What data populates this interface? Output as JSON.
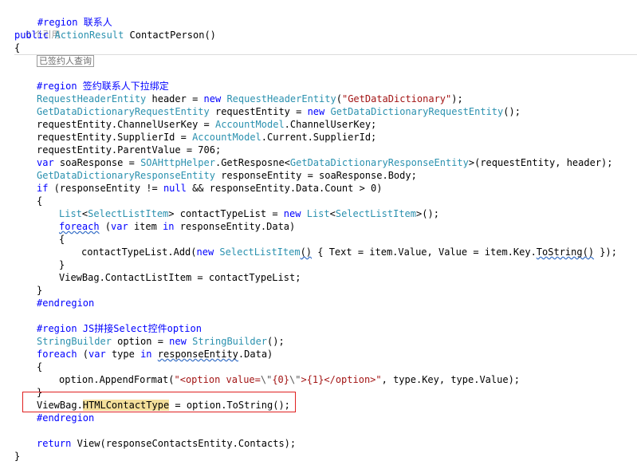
{
  "code": {
    "region_contact": "#region 联系人",
    "references": "0 个引用",
    "method_modifier": "public",
    "method_return_type": "ActionResult",
    "method_name": " ContactPerson()",
    "open_brace": "{",
    "collapsed_block_label": "已签约人查询",
    "region_signed_contact": "#region 签约联系人下拉绑定",
    "l1_type": "RequestHeaderEntity",
    "l1_mid": " header = ",
    "l1_new": "new",
    "l1_type2": "RequestHeaderEntity",
    "l1_paren": "(",
    "l1_str": "\"GetDataDictionary\"",
    "l1_end": ");",
    "l2_type": "GetDataDictionaryRequestEntity",
    "l2_mid": " requestEntity = ",
    "l2_new": "new",
    "l2_type2": "GetDataDictionaryRequestEntity",
    "l2_end": "();",
    "l3_a": "requestEntity.ChannelUserKey = ",
    "l3_type": "AccountModel",
    "l3_b": ".ChannelUserKey;",
    "l4_a": "requestEntity.SupplierId = ",
    "l4_type": "AccountModel",
    "l4_b": ".Current.SupplierId;",
    "l5": "requestEntity.ParentValue = 706;",
    "l6_var": "var",
    "l6_a": " soaResponse = ",
    "l6_type": "SOAHttpHelper",
    "l6_b": ".GetResposne<",
    "l6_type2": "GetDataDictionaryResponseEntity",
    "l6_c": ">(requestEntity, header);",
    "l7_type": "GetDataDictionaryResponseEntity",
    "l7_a": " responseEntity = soaResponse.Body;",
    "l8_if": "if",
    "l8_a": " (responseEntity != ",
    "l8_null": "null",
    "l8_b": " && responseEntity.Data.Count > 0)",
    "l9": "{",
    "l10_list": "List",
    "l10_a": "<",
    "l10_type": "SelectListItem",
    "l10_b": "> contactTypeList = ",
    "l10_new": "new",
    "l10_list2": "List",
    "l10_c": "<",
    "l10_type2": "SelectListItem",
    "l10_d": ">();",
    "l11_foreach": "foreach",
    "l11_a": " (",
    "l11_var": "var",
    "l11_b": " item ",
    "l11_in": "in",
    "l11_c": " responseEntity.Data)",
    "l12": "{",
    "l13_a": "contactTypeList.Add(",
    "l13_new": "new",
    "l13_type": "SelectListItem",
    "l13_paren": "()",
    "l13_b": " { Text = item.Value, Value = item.Key.",
    "l13_tostring": "ToString()",
    "l13_c": " });",
    "l14": "}",
    "l15": "ViewBag.ContactListItem = contactTypeList;",
    "l16": "}",
    "endregion_1": "#endregion",
    "region_js": "#region JS拼接Select控件option",
    "l17_type": "StringBuilder",
    "l17_a": " option = ",
    "l17_new": "new",
    "l17_type2": "StringBuilder",
    "l17_b": "();",
    "l18_foreach": "foreach",
    "l18_a": " (",
    "l18_var": "var",
    "l18_b": " type ",
    "l18_in": "in",
    "l18_c": " ",
    "l18_resp": "responseEntity",
    "l18_d": ".Data)",
    "l19": "{",
    "l20_a": "option.AppendFormat(",
    "l20_s1": "\"<option value=",
    "l20_e1": "\\\"",
    "l20_s2": "{0}",
    "l20_e2": "\\\"",
    "l20_s3": ">{1}</option>\"",
    "l20_b": ", type.Key, type.Value);",
    "l21": "}",
    "l22_a": "ViewBag.",
    "l22_hl": "HTMLContactType",
    "l22_b": " = option.ToString();",
    "endregion_2": "#endregion",
    "l23_return": "return",
    "l23_a": " View(responseContactsEntity.Contacts);",
    "close_brace": "}"
  },
  "colors": {
    "keyword": "#0000ff",
    "type": "#2b91af",
    "string": "#a31515",
    "highlight": "#f4df9b",
    "annotation_box": "#e02020"
  }
}
